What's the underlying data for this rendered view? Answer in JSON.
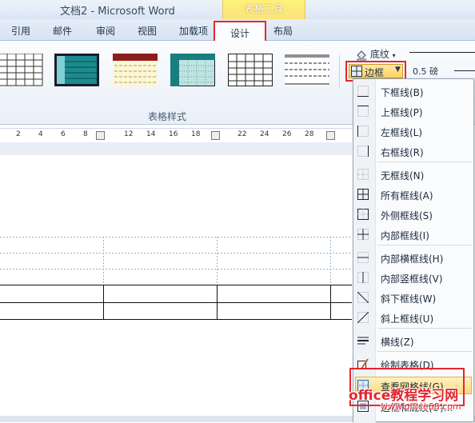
{
  "window": {
    "title": "文档2 - Microsoft Word",
    "context_tab_group": "表格工具"
  },
  "tabs": [
    {
      "label": "引用"
    },
    {
      "label": "邮件"
    },
    {
      "label": "审阅"
    },
    {
      "label": "视图"
    },
    {
      "label": "加载项"
    },
    {
      "label": "设计",
      "active": true
    },
    {
      "label": "布局"
    }
  ],
  "ribbon": {
    "group_label": "表格样式",
    "shading_label": "底纹",
    "borders_label": "边框",
    "pen_weight": "0.5 磅"
  },
  "ruler": {
    "ticks": [
      "2",
      "4",
      "6",
      "8",
      "12",
      "14",
      "16",
      "18",
      "22",
      "24",
      "26",
      "28"
    ]
  },
  "borders_menu": {
    "items": [
      {
        "label": "下框线(B)",
        "icon": "border-bottom-icon"
      },
      {
        "label": "上框线(P)",
        "icon": "border-top-icon"
      },
      {
        "label": "左框线(L)",
        "icon": "border-left-icon"
      },
      {
        "label": "右框线(R)",
        "icon": "border-right-icon"
      },
      {
        "label": "无框线(N)",
        "icon": "border-none-icon"
      },
      {
        "label": "所有框线(A)",
        "icon": "border-all-icon"
      },
      {
        "label": "外侧框线(S)",
        "icon": "border-outside-icon"
      },
      {
        "label": "内部框线(I)",
        "icon": "border-inside-icon"
      },
      {
        "label": "内部横框线(H)",
        "icon": "border-inside-horizontal-icon"
      },
      {
        "label": "内部竖框线(V)",
        "icon": "border-inside-vertical-icon"
      },
      {
        "label": "斜下框线(W)",
        "icon": "diagonal-down-icon"
      },
      {
        "label": "斜上框线(U)",
        "icon": "diagonal-up-icon"
      },
      {
        "label": "横线(Z)",
        "icon": "horizontal-line-icon"
      },
      {
        "label": "绘制表格(D)",
        "icon": "draw-table-icon"
      },
      {
        "label": "查看网格线(G)",
        "icon": "view-gridlines-icon",
        "highlighted": true
      },
      {
        "label": "边框和底纹(O)...",
        "icon": "borders-shading-icon"
      }
    ]
  },
  "watermark": {
    "text": "office教程学习网",
    "url": "www.office68.com"
  },
  "colors": {
    "highlight_red": "#e6262e",
    "menu_hover": "#ffd97a",
    "context_tab": "#fbe37a"
  }
}
